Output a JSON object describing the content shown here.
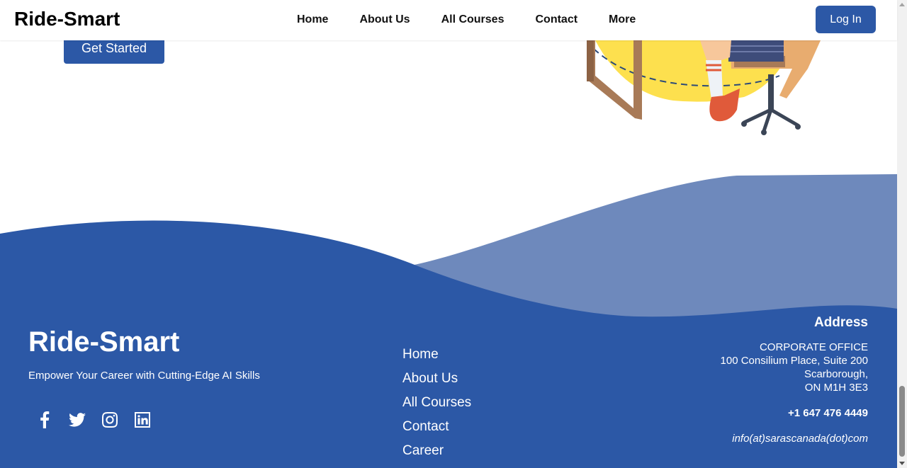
{
  "header": {
    "brand": "Ride-Smart",
    "nav": [
      "Home",
      "About Us",
      "All Courses",
      "Contact",
      "More"
    ],
    "login_label": "Log In"
  },
  "hero": {
    "cta_label": "Get Started"
  },
  "footer": {
    "brand": "Ride-Smart",
    "tagline": "Empower Your Career with Cutting-Edge AI Skills",
    "socials": [
      "facebook-icon",
      "twitter-icon",
      "instagram-icon",
      "linkedin-icon"
    ],
    "links": [
      "Home",
      "About Us",
      "All Courses",
      "Contact",
      "Career"
    ],
    "address": {
      "title": "Address",
      "office": "CORPORATE OFFICE",
      "street": "100 Consilium Place, Suite 200",
      "city": "Scarborough,",
      "postal": "ON M1H 3E3",
      "phone": "+1 647 476 4449",
      "email": "info(at)sarascanada(dot)com"
    }
  },
  "colors": {
    "primary": "#2c58a6",
    "wave_light": "#6e89bc",
    "illustration_yellow": "#fde04e",
    "illustration_wood": "#a87a57"
  }
}
